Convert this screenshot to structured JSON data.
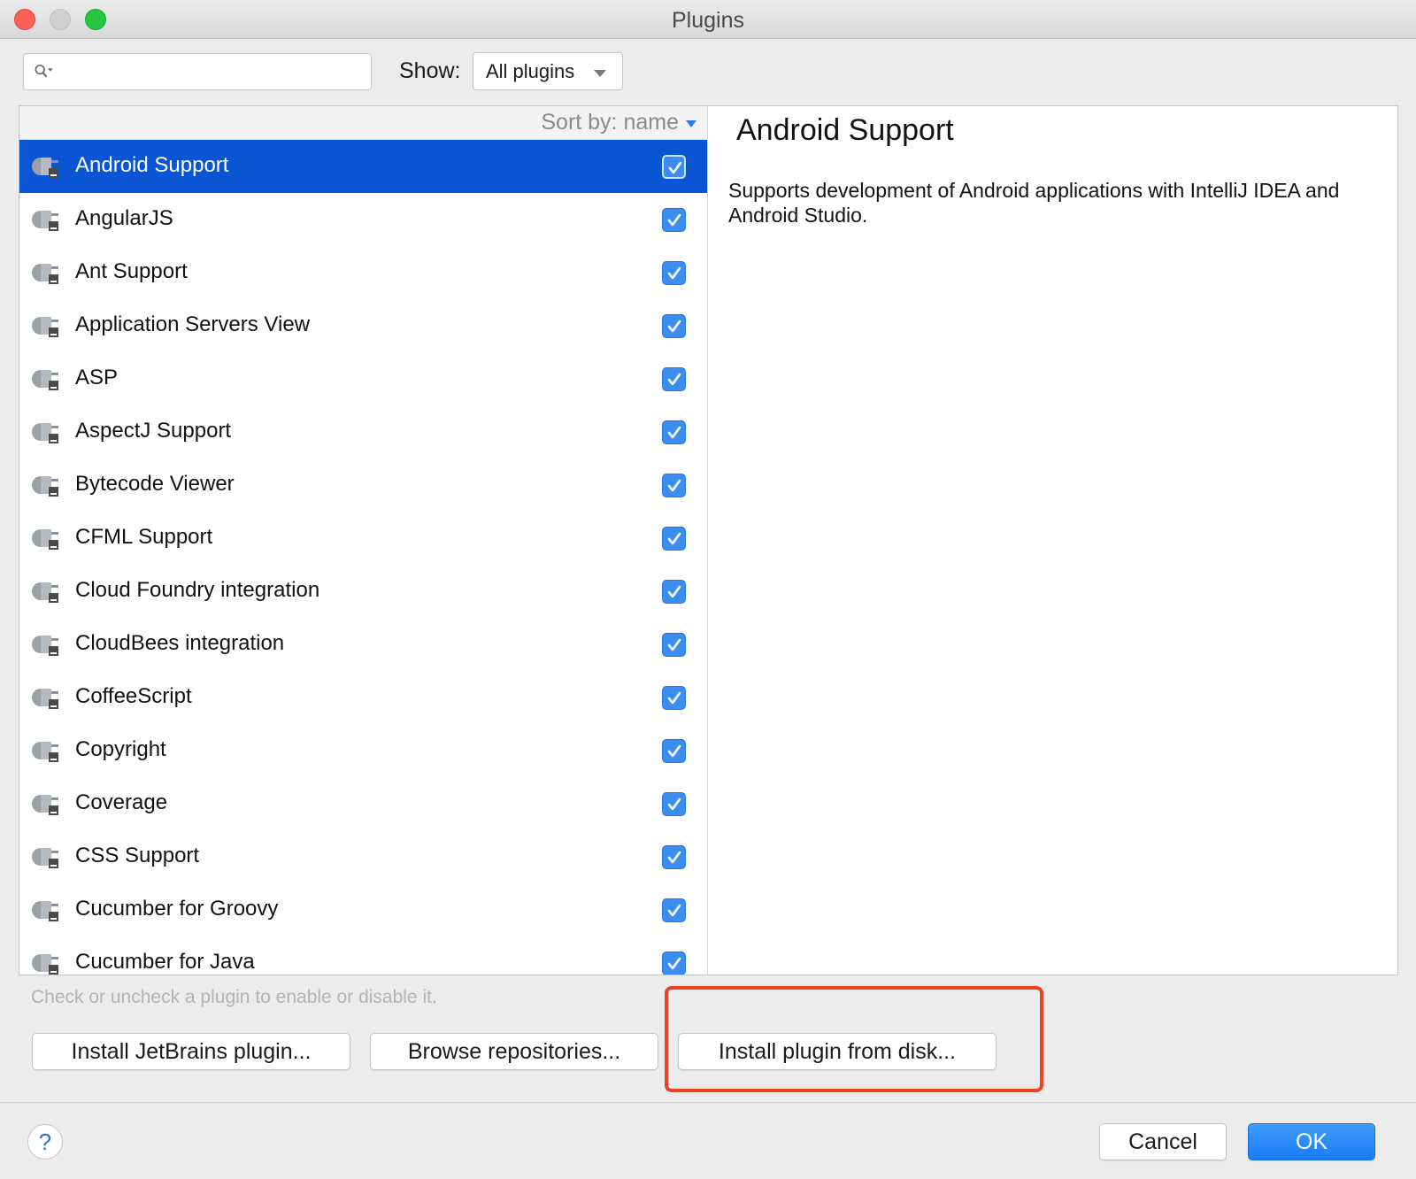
{
  "window": {
    "title": "Plugins"
  },
  "search": {
    "value": "",
    "placeholder": ""
  },
  "show": {
    "label": "Show:",
    "selected": "All plugins"
  },
  "list": {
    "sort_label": "Sort by: name",
    "items": [
      {
        "name": "Android Support",
        "checked": true,
        "selected": true
      },
      {
        "name": "AngularJS",
        "checked": true
      },
      {
        "name": "Ant Support",
        "checked": true
      },
      {
        "name": "Application Servers View",
        "checked": true
      },
      {
        "name": "ASP",
        "checked": true
      },
      {
        "name": "AspectJ Support",
        "checked": true
      },
      {
        "name": "Bytecode Viewer",
        "checked": true
      },
      {
        "name": "CFML Support",
        "checked": true
      },
      {
        "name": "Cloud Foundry integration",
        "checked": true
      },
      {
        "name": "CloudBees integration",
        "checked": true
      },
      {
        "name": "CoffeeScript",
        "checked": true
      },
      {
        "name": "Copyright",
        "checked": true
      },
      {
        "name": "Coverage",
        "checked": true
      },
      {
        "name": "CSS Support",
        "checked": true
      },
      {
        "name": "Cucumber for Groovy",
        "checked": true
      },
      {
        "name": "Cucumber for Java",
        "checked": true
      }
    ]
  },
  "detail": {
    "title": "Android Support",
    "description": "Supports development of Android applications with IntelliJ IDEA and Android Studio."
  },
  "hint": "Check or uncheck a plugin to enable or disable it.",
  "actions": {
    "install_jetbrains": "Install JetBrains plugin...",
    "browse_repositories": "Browse repositories...",
    "install_from_disk": "Install plugin from disk..."
  },
  "footer": {
    "help": "?",
    "cancel": "Cancel",
    "ok": "OK"
  },
  "colors": {
    "selection": "#0a55d3",
    "checkbox": "#3b8ef0",
    "highlight": "#ef4023",
    "primary_button": "#1a7cf5"
  }
}
